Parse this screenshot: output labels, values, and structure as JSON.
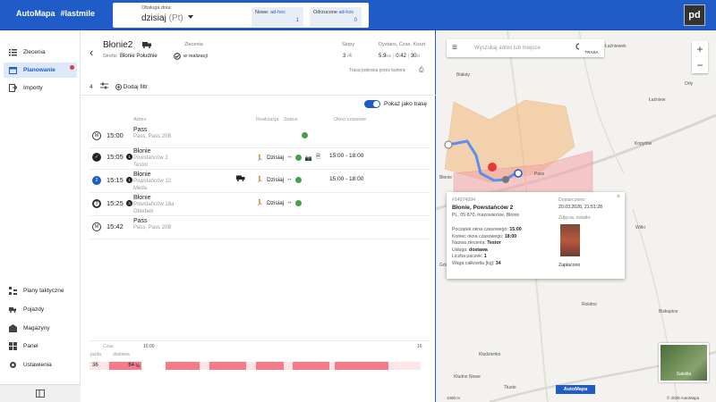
{
  "app": {
    "logo": "AutoMapa",
    "tag": "#lastmile"
  },
  "topbar": {
    "service_label": "Obsługa dnia:",
    "service_day": "dzisiaj",
    "service_day_suffix": "(Pt)",
    "new_label": "Nowe:",
    "new_type": "ad-hoc",
    "new_count": "1",
    "rejected_label": "Odrzucone",
    "rejected_type": "ad-hoc",
    "rejected_count": "0",
    "avatar": "pd"
  },
  "sidebar": {
    "items": [
      {
        "label": "Zlecenia",
        "icon": "list-icon"
      },
      {
        "label": "Planowanie",
        "icon": "calendar-icon"
      },
      {
        "label": "Importy",
        "icon": "import-icon"
      }
    ],
    "bottom_items": [
      {
        "label": "Plany taktyczne",
        "icon": "tactical-plan-icon"
      },
      {
        "label": "Pojazdy",
        "icon": "truck-icon"
      },
      {
        "label": "Magazyny",
        "icon": "warehouse-icon"
      },
      {
        "label": "Panel",
        "icon": "dashboard-icon"
      },
      {
        "label": "Ustawienia",
        "icon": "gear-icon"
      }
    ]
  },
  "route": {
    "name": "Błonie2",
    "zone_label": "Strefa:",
    "zone_value": "Błonie Południe",
    "orders_label": "Zlecenia",
    "orders_status": "w realizacji",
    "stops_label": "Stopy",
    "stops_value": "3",
    "stops_total": "/4",
    "dist_label": "Dystans, Czas, Koszt",
    "dist_value": "5.9",
    "dist_unit": "km",
    "time_value": "0:42",
    "cost_value": "30",
    "cost_unit": "zł",
    "fetched_text": "Trasa pobrana przez kuriera",
    "filter_count": "4",
    "add_filter": "Dodaj filtr",
    "show_as_route": "Pokaż jako trasę"
  },
  "table": {
    "headers": [
      "Adres",
      "Realizacja",
      "Status",
      "Okno czasowe"
    ],
    "rows": [
      {
        "badge": "M",
        "time": "15:00",
        "title": "Pass",
        "addr": "Pass, Pass 20B",
        "sub": "",
        "real": "",
        "window": ""
      },
      {
        "badge": "✓",
        "time": "15:05",
        "seq": "1",
        "title": "Błonie",
        "addr": "Powstańców 2",
        "sub": "Testor",
        "real": "Dzisiaj",
        "window": "15:00 - 18:00"
      },
      {
        "badge": "2",
        "time": "15:15",
        "seq": "1",
        "title": "Błonie",
        "addr": "Powstańców 12",
        "sub": "Meda",
        "real": "Dzisiaj",
        "window": "15:00 - 18:00"
      },
      {
        "badge": "3",
        "time": "15:25",
        "seq": "3",
        "title": "Błonie",
        "addr": "Powstańców 18a",
        "sub": "Oblebek",
        "real": "Dzisiaj",
        "window": ""
      },
      {
        "badge": "M",
        "time": "15:42",
        "title": "Pass",
        "addr": "Pass, Pass 20B",
        "sub": "",
        "real": "",
        "window": ""
      }
    ]
  },
  "timeline": {
    "label_time": "Czas",
    "start_time": "15:00",
    "end_time": "16",
    "drive_label": "jazda",
    "drive_value": "36",
    "delivery_label": "dostawa",
    "delivery_value": "64",
    "delivery_unit": "%"
  },
  "map": {
    "search_placeholder": "Wyszukaj adres lub miejsce",
    "trasa_label": "TRASA",
    "zoom_in": "+",
    "zoom_out": "−",
    "satellite": "Satelita",
    "logo": "AutoMapa",
    "copyright": "© 2026 AutoMapa",
    "scale": "1000 m",
    "places": [
      "Radzików",
      "Łaźniewek",
      "Białuty",
      "Łaźniew",
      "Orły",
      "Kopytów",
      "Błonie",
      "Pass",
      "Witki",
      "Kłudno Nowe",
      "Tłuste",
      "Biskupice",
      "Kłudzienko",
      "Rokitno",
      "Górna Wieś",
      "Pass"
    ],
    "popup": {
      "id": "#14974994",
      "name": "Błonie, Powstańców 2",
      "address": "PL, 05-870, mazowieckie, Błonie",
      "delivered_label": "Dostarczono:",
      "delivered_value": "20.03.2026, 21:51:28",
      "photos_label": "Zdjęcia, notatki:",
      "paid_label": "Zapłacono",
      "fields": [
        {
          "k": "Początek okna czasowego:",
          "v": "15:00"
        },
        {
          "k": "Koniec okna czasowego:",
          "v": "18:00"
        },
        {
          "k": "Nazwa zlecenia:",
          "v": "Testor"
        },
        {
          "k": "Usługa:",
          "v": "dostawa"
        },
        {
          "k": "Liczba paczek:",
          "v": "1"
        },
        {
          "k": "Waga całkowita [kg]:",
          "v": "34"
        }
      ]
    }
  },
  "colors": {
    "brand": "#1f5cc7",
    "danger": "#e53935",
    "success": "#43a047",
    "timeline_red": "#f47c8a",
    "zone_orange": "#f4b777",
    "zone_red": "#f4a3a8"
  }
}
